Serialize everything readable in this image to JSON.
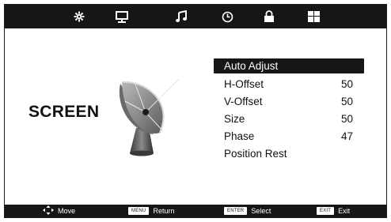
{
  "tabs": [
    {
      "icon": "picture-gear-icon"
    },
    {
      "icon": "screen-icon"
    },
    {
      "icon": "music-note-icon"
    },
    {
      "icon": "clock-icon"
    },
    {
      "icon": "lock-icon"
    },
    {
      "icon": "setup-grid-icon"
    }
  ],
  "section": {
    "title": "SCREEN",
    "icon": "satellite-dish-icon"
  },
  "menu": {
    "items": [
      {
        "label": "Auto Adjust",
        "value": ""
      },
      {
        "label": "H-Offset",
        "value": "50"
      },
      {
        "label": "V-Offset",
        "value": "50"
      },
      {
        "label": "Size",
        "value": "50"
      },
      {
        "label": "Phase",
        "value": "47"
      },
      {
        "label": "Position Rest",
        "value": ""
      }
    ],
    "selected_index": 0
  },
  "footer": {
    "move_label": "Move",
    "menu_key": "MENU",
    "return_label": "Return",
    "enter_key": "ENTER",
    "select_label": "Select",
    "exit_key": "EXIT",
    "exit_label": "Exit"
  },
  "colors": {
    "bar": "#161616",
    "highlight": "#161616",
    "text": "#111111"
  }
}
